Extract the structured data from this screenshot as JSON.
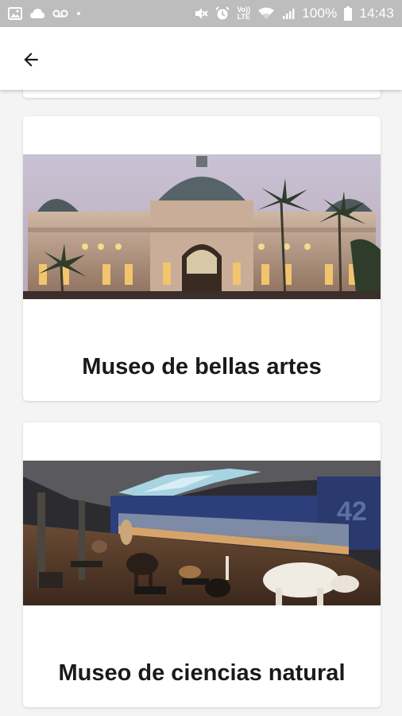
{
  "status_bar": {
    "battery": "100%",
    "time": "14:43",
    "volte_label": "Vo))\nLTE",
    "icons": [
      "image-icon",
      "cloud-icon",
      "voicemail-icon",
      "dot-icon",
      "mute-icon",
      "alarm-icon",
      "volte-icon",
      "wifi-icon",
      "signal-icon",
      "battery-icon"
    ]
  },
  "app_bar": {
    "back_icon": "arrow-back-icon"
  },
  "museums": [
    {
      "title": "Museo de bellas artes",
      "image": "museum-bellas-artes-photo"
    },
    {
      "title": "Museo de ciencias natural",
      "image": "museum-ciencias-natural-photo"
    }
  ],
  "colors": {
    "status_bar": "#bdbdbd",
    "background": "#f4f4f4",
    "card": "#ffffff",
    "title_text": "#1a1a1a"
  }
}
